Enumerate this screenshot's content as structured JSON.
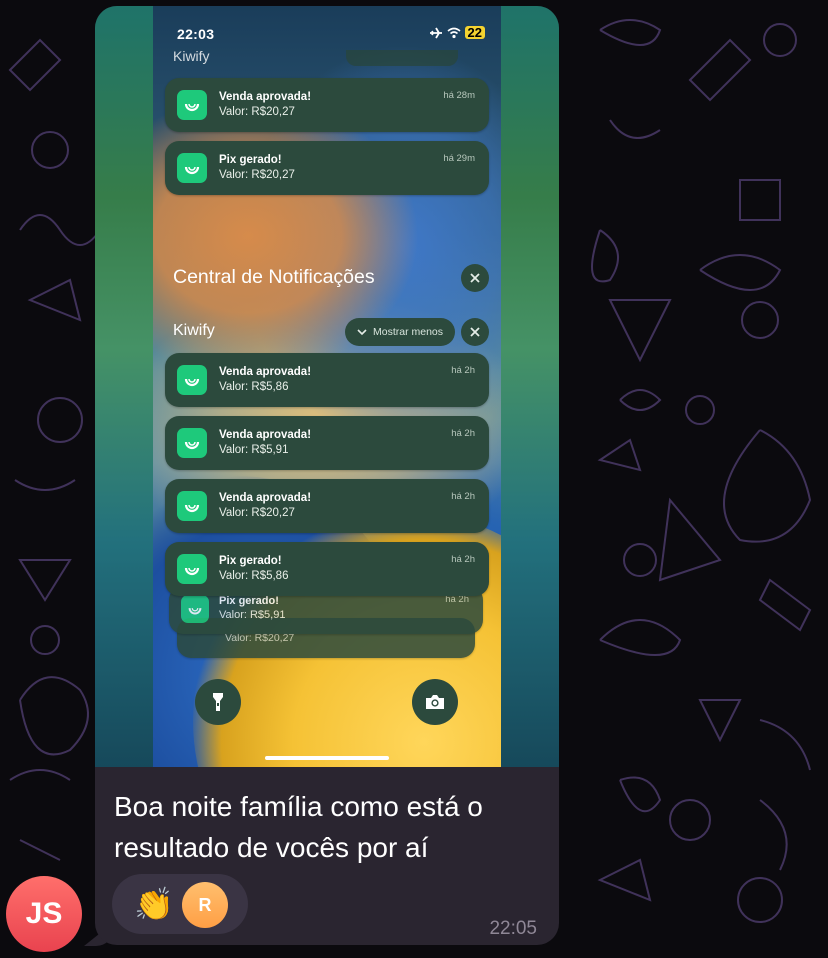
{
  "status_bar": {
    "time": "22:03",
    "airplane_icon": "airplane-icon",
    "wifi_icon": "wifi-icon",
    "battery": "22"
  },
  "top_cutoff": {
    "app_label": "Kiwify"
  },
  "top_notifications": [
    {
      "title": "Venda aprovada!",
      "body": "Valor: R$20,27",
      "age": "há 28m",
      "icon": "kiwify-app-icon"
    },
    {
      "title": "Pix gerado!",
      "body": "Valor: R$20,27",
      "age": "há 29m",
      "icon": "kiwify-app-icon"
    }
  ],
  "notification_center": {
    "heading": "Central de Notificações",
    "group": {
      "app_name": "Kiwify",
      "show_less_label": "Mostrar menos",
      "notifications": [
        {
          "title": "Venda aprovada!",
          "body": "Valor: R$5,86",
          "age": "há 2h"
        },
        {
          "title": "Venda aprovada!",
          "body": "Valor: R$5,91",
          "age": "há 2h"
        },
        {
          "title": "Venda aprovada!",
          "body": "Valor: R$20,27",
          "age": "há 2h"
        },
        {
          "title": "Pix gerado!",
          "body": "Valor: R$5,86",
          "age": "há 2h"
        }
      ],
      "stacked": [
        {
          "title": "Pix gerado!",
          "body": "Valor: R$5,91",
          "age": "há 2h"
        },
        {
          "body": "Valor: R$20,27"
        }
      ]
    }
  },
  "lockscreen_buttons": {
    "flashlight": "flashlight-icon",
    "camera": "camera-icon"
  },
  "message": {
    "text": "Boa noite família como está o resultado de vocês por aí",
    "time": "22:05",
    "reaction_emoji": "👏",
    "reactor_initial": "R",
    "sender_initials": "JS"
  },
  "colors": {
    "bubble": "#2a2530",
    "notification": "#2c4a3d",
    "kiwify_green": "#1ec97b",
    "sender_avatar": "#e9434f",
    "reactor_avatar": "#ff9f45"
  }
}
